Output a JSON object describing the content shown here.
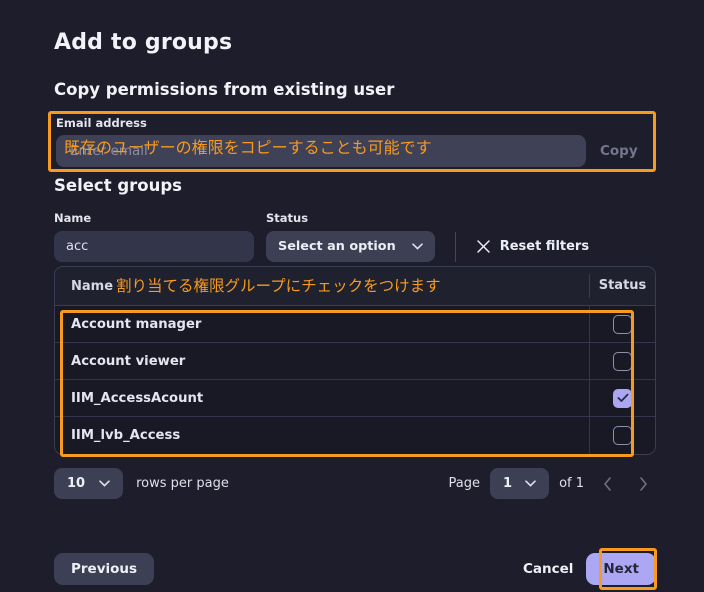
{
  "dialog": {
    "title": "Add to groups",
    "section_copy_permissions": "Copy permissions from existing user",
    "section_select_groups": "Select groups"
  },
  "email": {
    "label": "Email address",
    "value": "",
    "placeholder": "Enter email",
    "copy_label": "Copy"
  },
  "filters": {
    "name_label": "Name",
    "name_value": "acc",
    "name_placeholder": "",
    "status_label": "Status",
    "status_value": "Select an option",
    "reset_label": "Reset filters"
  },
  "table": {
    "columns": [
      "Name",
      "Status"
    ],
    "rows": [
      {
        "name": "Account manager",
        "checked": false
      },
      {
        "name": "Account viewer",
        "checked": false
      },
      {
        "name": "IIM_AccessAcount",
        "checked": true
      },
      {
        "name": "IIM_lvb_Access",
        "checked": false
      }
    ]
  },
  "pagination": {
    "rows_per_page_value": "10",
    "rows_per_page_label": "rows per page",
    "page_label": "Page",
    "page_value": "1",
    "of_label": "of 1"
  },
  "footer": {
    "previous": "Previous",
    "cancel": "Cancel",
    "next": "Next"
  },
  "annotations": {
    "email_note": "既存のユーザーの権限をコピーすることも可能です",
    "table_note": "割り当てる権限グループにチェックをつけます",
    "color": "#f79a1e"
  }
}
